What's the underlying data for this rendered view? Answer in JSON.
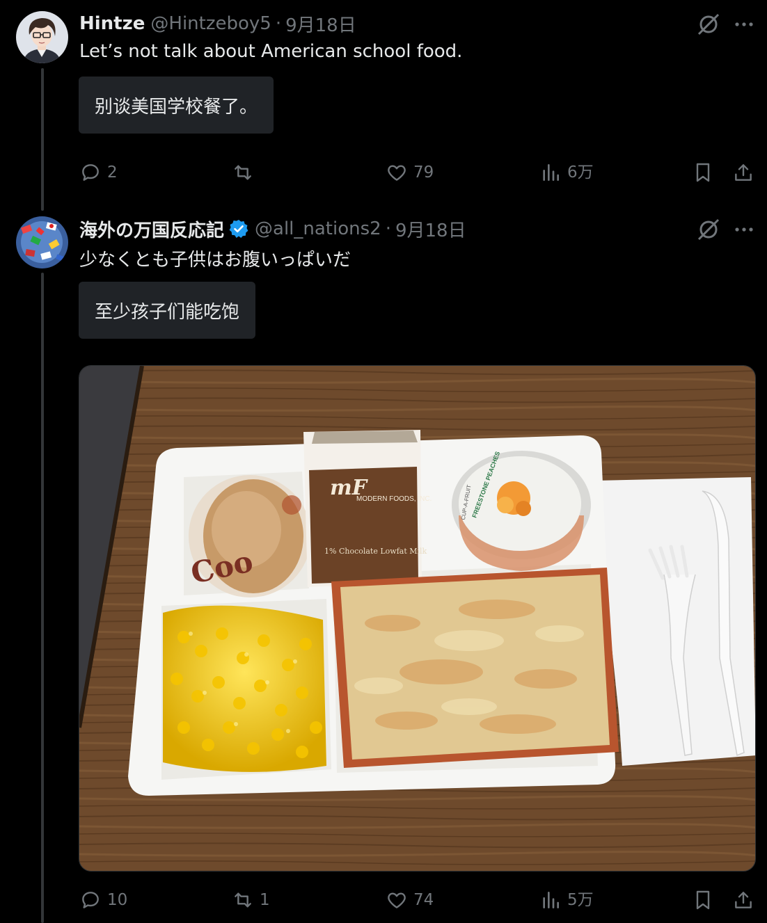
{
  "tweets": [
    {
      "display_name": "Hintze",
      "handle": "@Hintzeboy5",
      "separator": "·",
      "date": "9月18日",
      "text": "Let’s not talk about American school food.",
      "translation": "别谈美国学校餐了。",
      "replies": "2",
      "retweets": "",
      "likes": "79",
      "views": "6万"
    },
    {
      "display_name": "海外の万国反応記",
      "handle": "@all_nations2",
      "separator": "·",
      "date": "9月18日",
      "text": "少なくとも子供はお腹いっぱいだ",
      "translation": "至少孩子们能吃饱",
      "replies": "10",
      "retweets": "1",
      "likes": "74",
      "views": "5万",
      "image": {
        "milk_brand": "MODERN FOODS, INC.",
        "milk_label": "1% Chocolate Lowfat Milk",
        "cup_label": "FREESTONE PEACHES",
        "cup_brand": "CUP-A-FRUIT",
        "cookie_label": "Coo"
      }
    }
  ],
  "icons": {
    "reply": "reply-icon",
    "retweet": "retweet-icon",
    "like": "heart-icon",
    "views": "views-icon",
    "bookmark": "bookmark-icon",
    "share": "share-icon",
    "grok": "grok-icon",
    "more": "more-icon",
    "verified": "verified-badge-icon"
  },
  "colors": {
    "background": "#000000",
    "text": "#e7e9ea",
    "muted": "#71767b",
    "verified": "#1d9bf0",
    "translation_bg": "#202327"
  }
}
